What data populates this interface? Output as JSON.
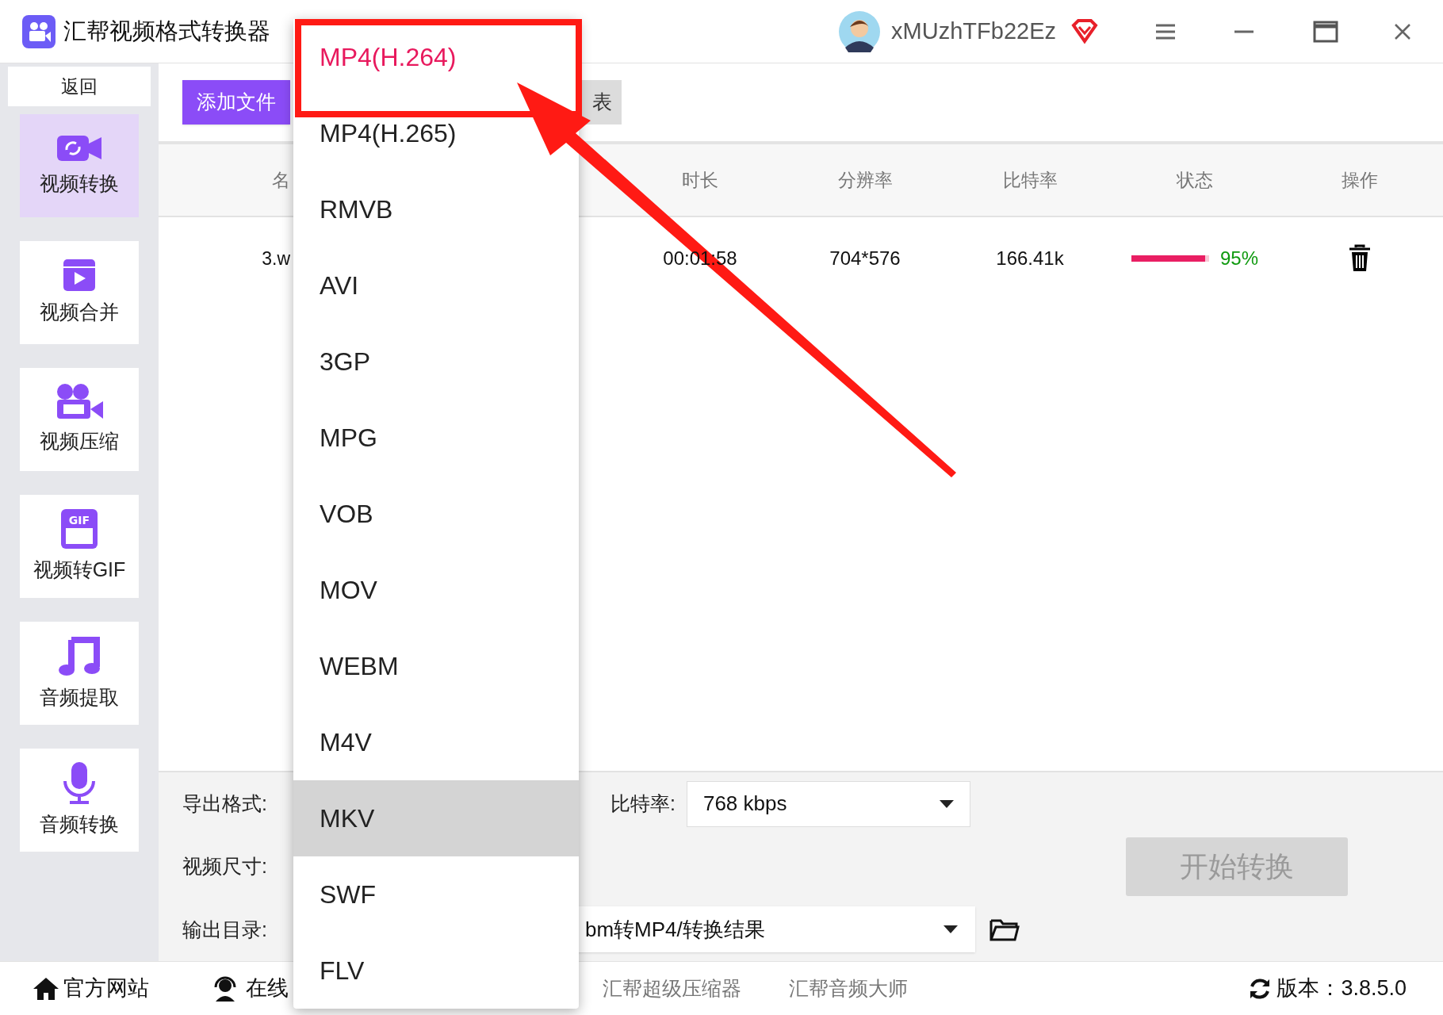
{
  "window": {
    "title": "汇帮视频格式转换器",
    "username": "xMUzhTFb22Ez"
  },
  "sidebar": {
    "back": "返回",
    "items": [
      {
        "label": "视频转换",
        "kind": "convert",
        "selected": true
      },
      {
        "label": "视频合并",
        "kind": "merge",
        "selected": false
      },
      {
        "label": "视频压缩",
        "kind": "compress",
        "selected": false
      },
      {
        "label": "视频转GIF",
        "kind": "gif",
        "selected": false,
        "icon_text": "GIF"
      },
      {
        "label": "音频提取",
        "kind": "extract",
        "selected": false
      },
      {
        "label": "音频转换",
        "kind": "audio",
        "selected": false
      }
    ]
  },
  "toolbar": {
    "add_files": "添加文件",
    "list_button": "表"
  },
  "table": {
    "columns": [
      "名",
      "时长",
      "分辨率",
      "比特率",
      "状态",
      "操作"
    ],
    "rows": [
      {
        "name": "3.w",
        "duration": "00:01:58",
        "resolution": "704*576",
        "bitrate": "166.41k",
        "level": 0.95,
        "progress": "95%"
      }
    ]
  },
  "settings": {
    "format_label": "导出格式:",
    "size_label": "视频尺寸:",
    "output_label": "输出目录:",
    "bitrate_label": "比特率:",
    "bitrate_value": "768 kbps",
    "output_value": "bm转MP4/转换结果",
    "start": "开始转换"
  },
  "format_menu": [
    {
      "label": "MP4(H.264)",
      "selected": true,
      "hovered": false
    },
    {
      "label": "MP4(H.265)",
      "selected": false,
      "hovered": false
    },
    {
      "label": "RMVB",
      "selected": false,
      "hovered": false
    },
    {
      "label": "AVI",
      "selected": false,
      "hovered": false
    },
    {
      "label": "3GP",
      "selected": false,
      "hovered": false
    },
    {
      "label": "MPG",
      "selected": false,
      "hovered": false
    },
    {
      "label": "VOB",
      "selected": false,
      "hovered": false
    },
    {
      "label": "MOV",
      "selected": false,
      "hovered": false
    },
    {
      "label": "WEBM",
      "selected": false,
      "hovered": false
    },
    {
      "label": "M4V",
      "selected": false,
      "hovered": false
    },
    {
      "label": "MKV",
      "selected": false,
      "hovered": true
    },
    {
      "label": "SWF",
      "selected": false,
      "hovered": false
    },
    {
      "label": "FLV",
      "selected": false,
      "hovered": false
    }
  ],
  "footer": {
    "website": "官方网站",
    "support": "在线",
    "links": [
      "汇帮超级压缩器",
      "汇帮音频大师"
    ],
    "version": "版本：3.8.5.0"
  }
}
